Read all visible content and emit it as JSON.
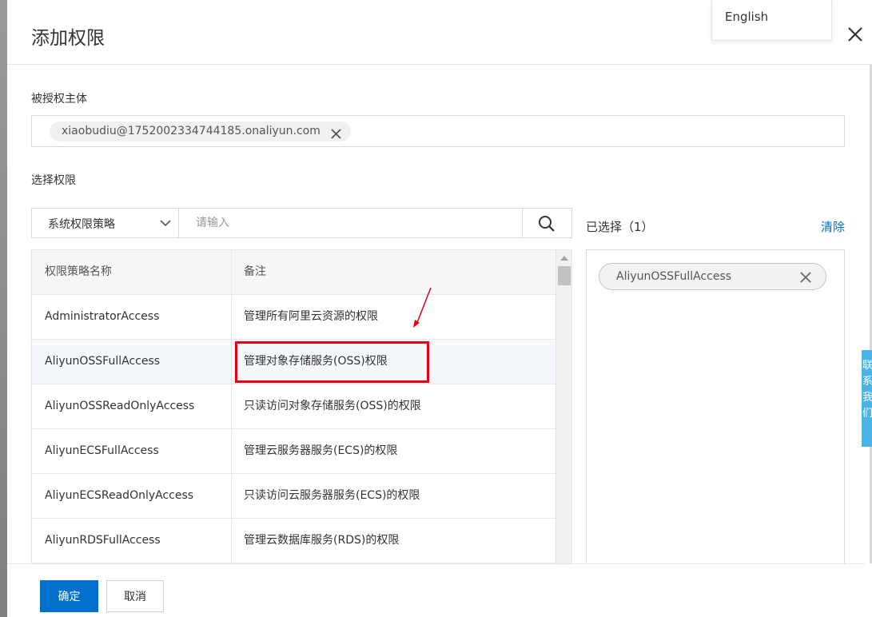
{
  "dialog": {
    "title": "添加权限",
    "language_option": "English"
  },
  "principal": {
    "label": "被授权主体",
    "chip": "xiaobudiu@1752002334744185.onaliyun.com"
  },
  "permissions": {
    "label": "选择权限",
    "policy_type": "系统权限策略",
    "search_placeholder": "请输入",
    "columns": [
      "权限策略名称",
      "备注"
    ],
    "rows": [
      {
        "name": "AdministratorAccess",
        "note": "管理所有阿里云资源的权限"
      },
      {
        "name": "AliyunOSSFullAccess",
        "note": "管理对象存储服务(OSS)权限"
      },
      {
        "name": "AliyunOSSReadOnlyAccess",
        "note": "只读访问对象存储服务(OSS)的权限"
      },
      {
        "name": "AliyunECSFullAccess",
        "note": "管理云服务器服务(ECS)的权限"
      },
      {
        "name": "AliyunECSReadOnlyAccess",
        "note": "只读访问云服务器服务(ECS)的权限"
      },
      {
        "name": "AliyunRDSFullAccess",
        "note": "管理云数据库服务(RDS)的权限"
      }
    ]
  },
  "selected": {
    "label": "已选择（1）",
    "clear_label": "清除",
    "items": [
      "AliyunOSSFullAccess"
    ]
  },
  "footer": {
    "ok_label": "确定",
    "cancel_label": "取消"
  },
  "side_tab": {
    "text": "联系我们"
  },
  "colors": {
    "primary": "#0070cc",
    "annotation": "#e60012",
    "selected_row": "#f5f8fd"
  },
  "icons": [
    "close-icon",
    "chevron-down-icon",
    "search-icon",
    "remove-icon",
    "annotation-arrow"
  ]
}
